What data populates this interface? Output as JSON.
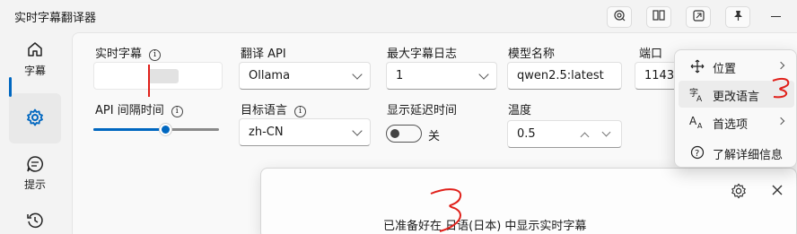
{
  "window": {
    "title": "实时字幕翻译器",
    "buttons": [
      "capture-icon",
      "columns-icon",
      "pip-icon",
      "pin-icon",
      "minimize-icon"
    ]
  },
  "sidebar": {
    "items": [
      {
        "label": "字幕",
        "icon": "home-icon"
      },
      {
        "label": "",
        "icon": "gear-icon",
        "active": true
      },
      {
        "label": "提示",
        "icon": "chat-icon"
      },
      {
        "label": "",
        "icon": "history-icon"
      }
    ]
  },
  "settings": {
    "live_caption": {
      "label": "实时字幕",
      "value": ""
    },
    "translate_api": {
      "label": "翻译 API",
      "value": "Ollama"
    },
    "max_log": {
      "label": "最大字幕日志",
      "value": "1"
    },
    "model_name": {
      "label": "模型名称",
      "value": "qwen2.5:latest"
    },
    "port": {
      "label": "端口",
      "value": "1143"
    },
    "api_interval": {
      "label": "API 间隔时间",
      "value": 0.58
    },
    "target_lang": {
      "label": "目标语言",
      "value": "zh-CN"
    },
    "show_delay": {
      "label": "显示延迟时间",
      "state": "关"
    },
    "temperature": {
      "label": "温度",
      "value": "0.5"
    }
  },
  "dialog": {
    "message": "已准备好在 日语(日本) 中显示实时字幕"
  },
  "context_menu": {
    "items": [
      {
        "label": "位置",
        "icon": "move-icon",
        "submenu": true
      },
      {
        "label": "更改语言",
        "icon": "language-icon",
        "submenu": false
      },
      {
        "label": "首选项",
        "icon": "text-size-icon",
        "submenu": true
      },
      {
        "label": "了解详细信息",
        "icon": "help-icon",
        "submenu": false
      }
    ]
  },
  "colors": {
    "accent": "#0067c0",
    "annotation": "#e0201a"
  }
}
